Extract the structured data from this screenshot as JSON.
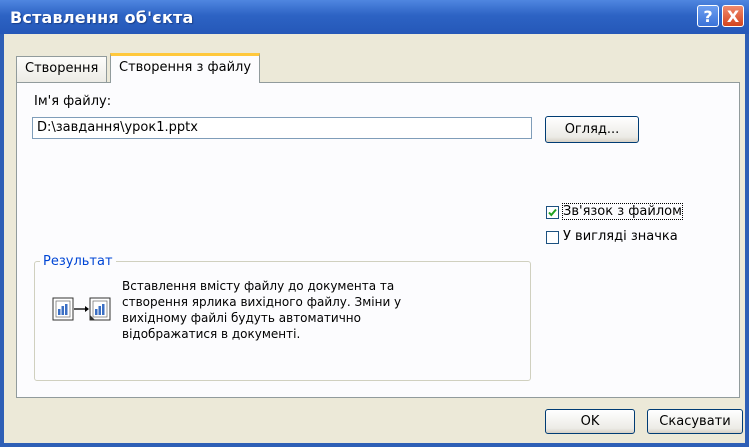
{
  "window": {
    "title": "Вставлення об'єкта"
  },
  "title_buttons": {
    "help": "?",
    "close": "X"
  },
  "tabs": [
    {
      "label": "Створення"
    },
    {
      "label": "Створення з файлу"
    }
  ],
  "form": {
    "file_name_label": "Ім'я файлу:",
    "file_name_value": "D:\\завдання\\урок1.pptx",
    "browse_label": "Огляд..."
  },
  "options": {
    "link_label": "Зв'язок з файлом",
    "link_checked": true,
    "icon_label": "У вигляді значка",
    "icon_checked": false
  },
  "result": {
    "legend": "Результат",
    "description": "Вставлення вмісту файлу до документа та створення ярлика вихідного файлу. Зміни у вихідному файлі будуть автоматично відображатися в документі."
  },
  "footer": {
    "ok_label": "OK",
    "cancel_label": "Скасувати"
  },
  "colors": {
    "title_bar": "#2d63c4",
    "dialog_bg": "#ece9d8",
    "accent_tab": "#ffc83c",
    "legend_text": "#0046d5"
  }
}
